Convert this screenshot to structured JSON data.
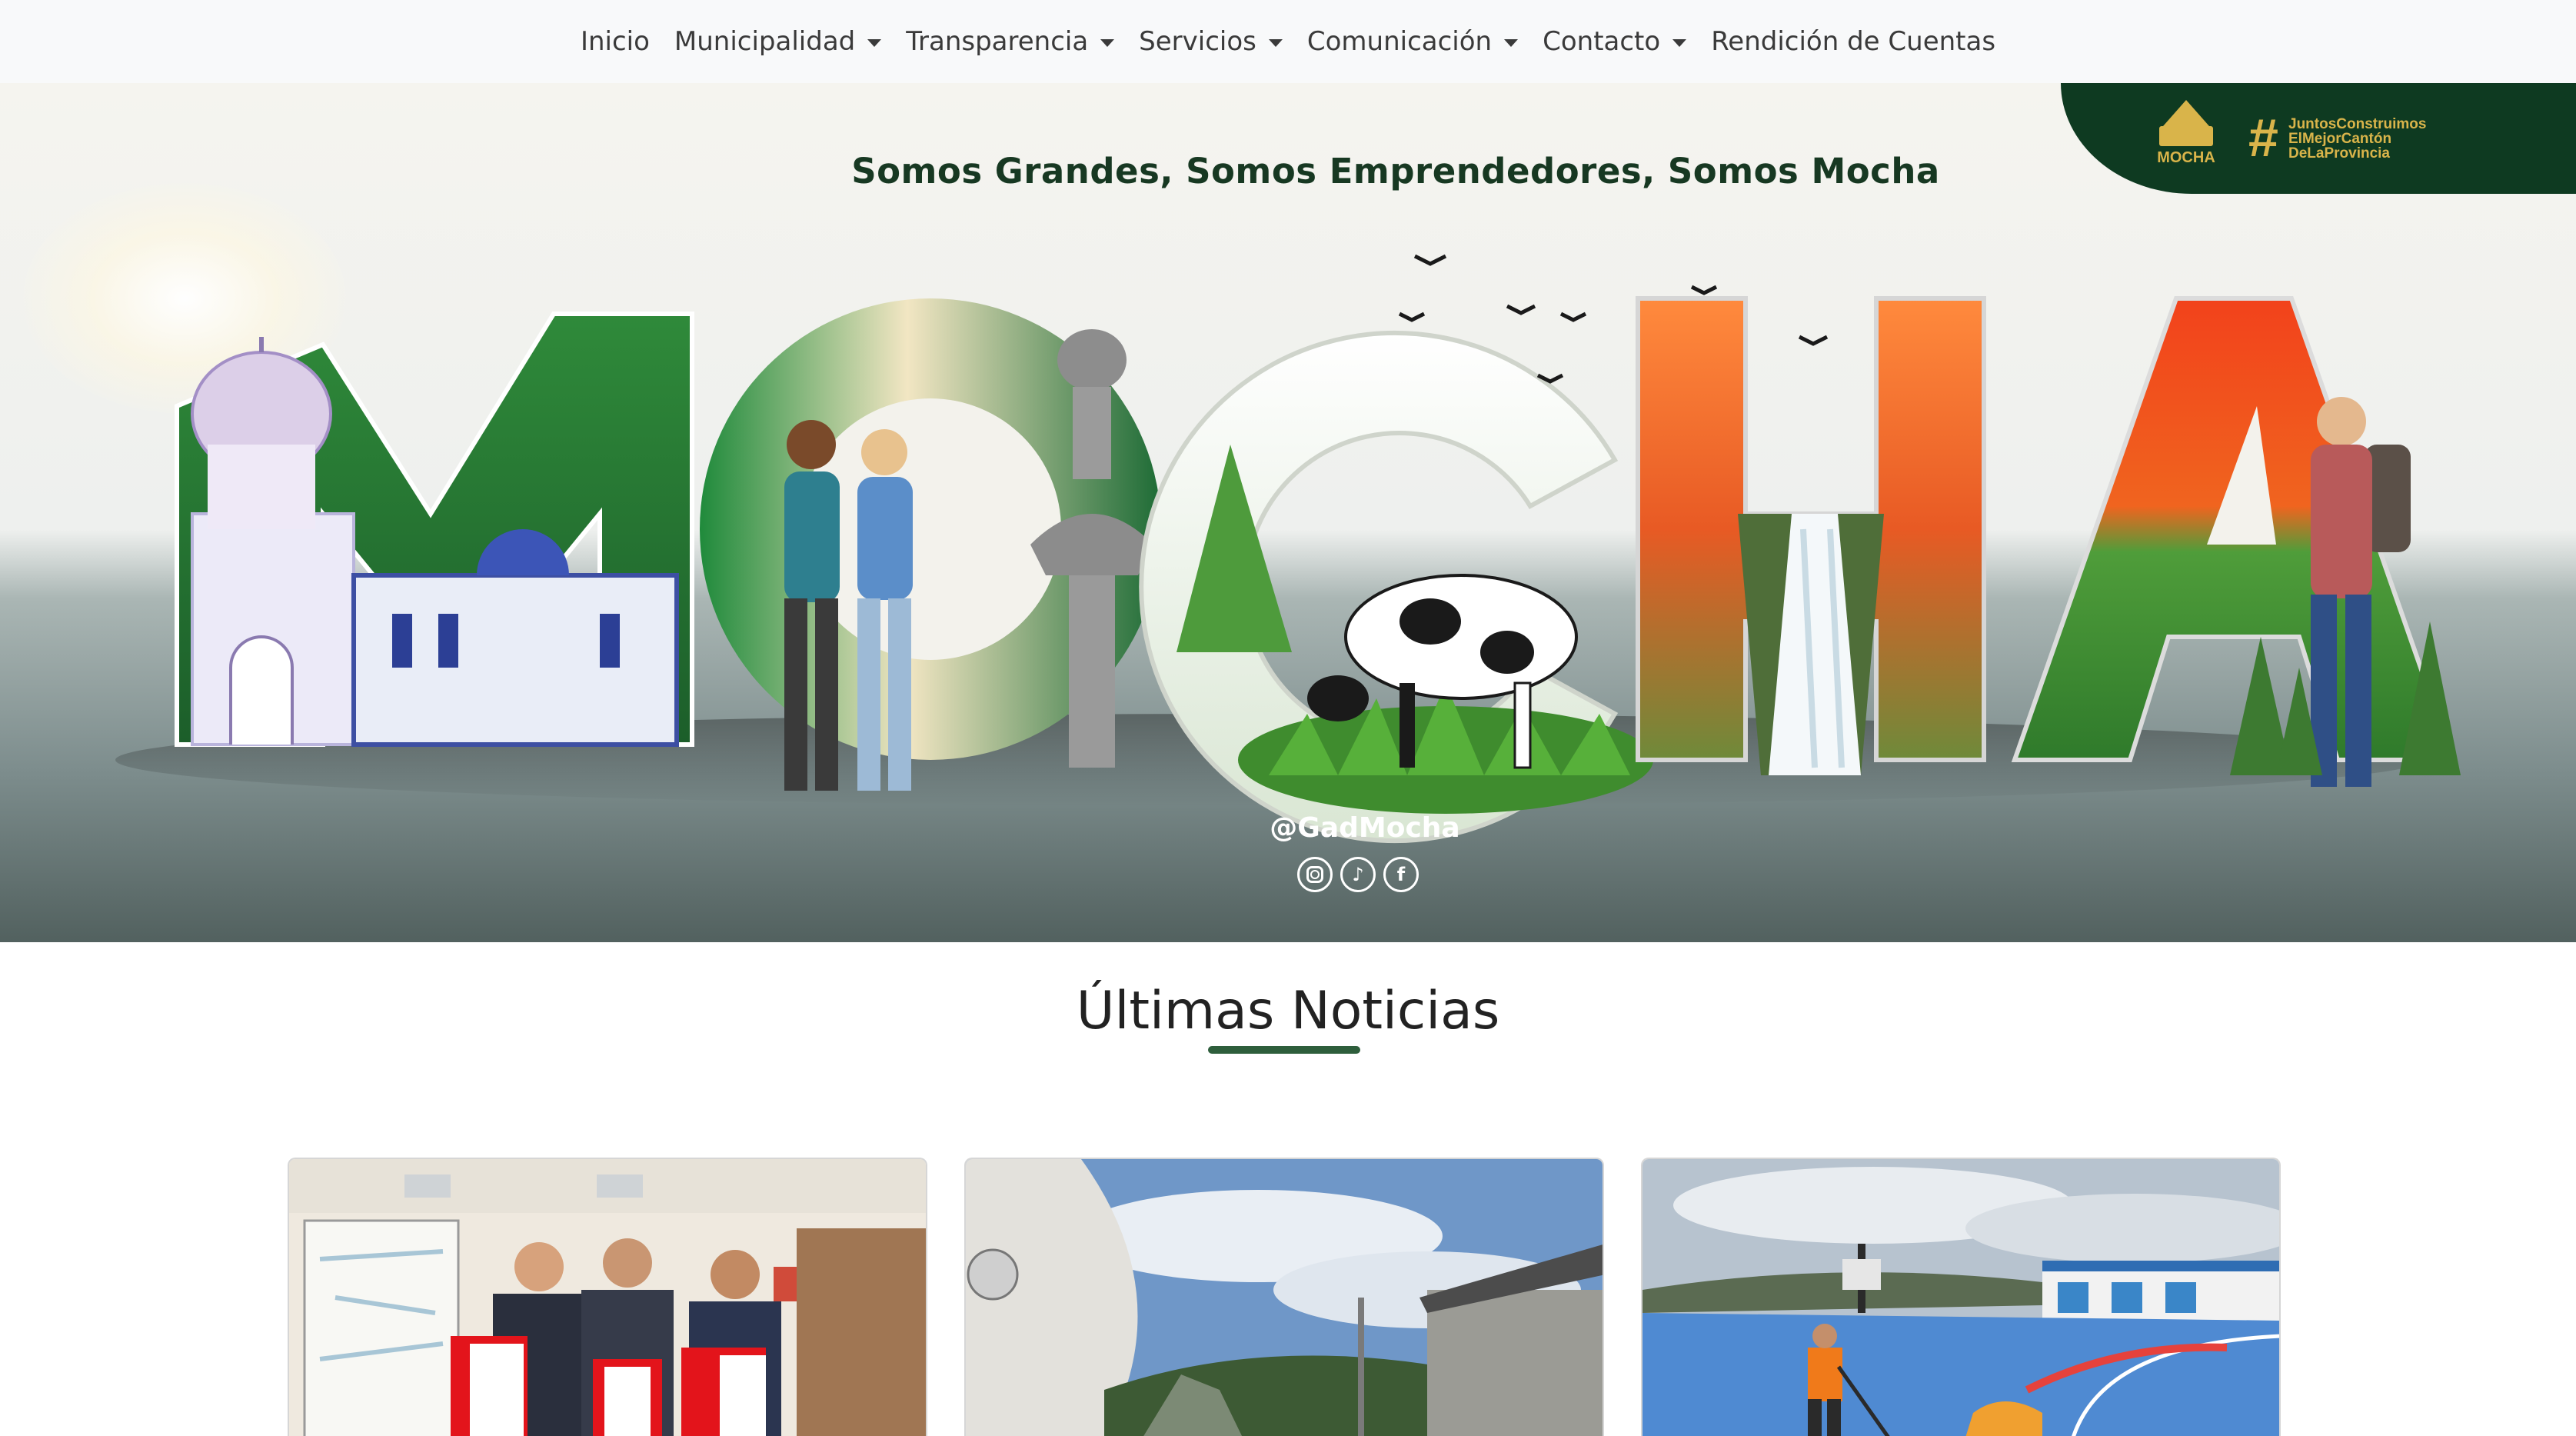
{
  "nav": {
    "items": [
      {
        "label": "Inicio",
        "dropdown": false
      },
      {
        "label": "Municipalidad",
        "dropdown": true
      },
      {
        "label": "Transparencia",
        "dropdown": true
      },
      {
        "label": "Servicios",
        "dropdown": true
      },
      {
        "label": "Comunicación",
        "dropdown": true
      },
      {
        "label": "Contacto",
        "dropdown": true
      },
      {
        "label": "Rendición de Cuentas",
        "dropdown": false
      }
    ]
  },
  "hero": {
    "slogan": "Somos Grandes, Somos Emprendedores, Somos Mocha",
    "big_word": "MOCHA",
    "handle": "@GadMocha",
    "brand": {
      "logo_text": "MOCHA",
      "hashtag_symbol": "#",
      "hashtag_lines": [
        "JuntosConstruimos",
        "ElMejorCantón",
        "DeLaProvincia"
      ]
    },
    "social_icons": [
      "instagram-icon",
      "tiktok-icon",
      "facebook-icon"
    ]
  },
  "news": {
    "title": "Últimas Noticias",
    "cards": [
      {
        "image": "signing-ceremony-photo"
      },
      {
        "image": "aircraft-hangar-photo"
      },
      {
        "image": "sports-court-photo"
      }
    ]
  },
  "colors": {
    "nav_bg": "#f8f9fa",
    "brand_green": "#0e3a21",
    "brand_gold": "#d9b44a",
    "accent_underline": "#2e5e3c"
  }
}
